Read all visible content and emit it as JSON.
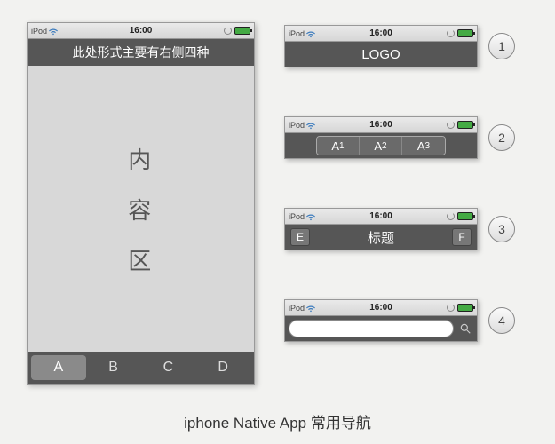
{
  "status": {
    "device": "iPod",
    "time": "16:00"
  },
  "main": {
    "title": "此处形式主要有右侧四种",
    "content": [
      "内",
      "容",
      "区"
    ],
    "tabs": [
      "A",
      "B",
      "C",
      "D"
    ]
  },
  "examples": {
    "e1": {
      "label": "LOGO",
      "num": "1"
    },
    "e2": {
      "segs": [
        {
          "a": "A",
          "n": "1"
        },
        {
          "a": "A",
          "n": "2"
        },
        {
          "a": "A",
          "n": "3"
        }
      ],
      "num": "2"
    },
    "e3": {
      "left": "E",
      "title": "标题",
      "right": "F",
      "num": "3"
    },
    "e4": {
      "placeholder": "",
      "num": "4"
    }
  },
  "caption": "iphone Native App 常用导航"
}
